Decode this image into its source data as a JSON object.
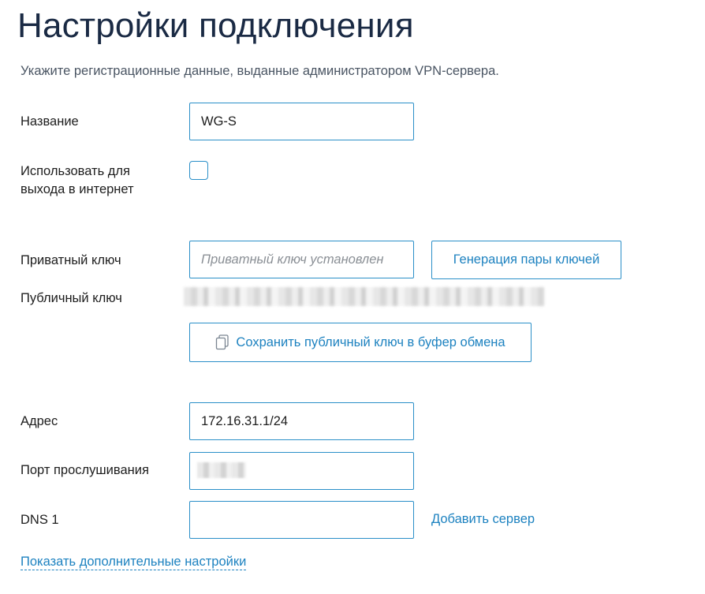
{
  "page": {
    "title": "Настройки подключения",
    "subtitle": "Укажите регистрационные данные, выданные администратором VPN-сервера."
  },
  "form": {
    "name": {
      "label": "Название",
      "value": "WG-S"
    },
    "internet": {
      "label_line1": "Использовать для",
      "label_line2": "выхода в интернет",
      "checked": false
    },
    "private_key": {
      "label": "Приватный ключ",
      "placeholder": "Приватный ключ установлен"
    },
    "generate_button": "Генерация пары ключей",
    "public_key": {
      "label": "Публичный ключ"
    },
    "copy_button": "Сохранить публичный ключ в буфер обмена",
    "address": {
      "label": "Адрес",
      "value": "172.16.31.1/24"
    },
    "listen_port": {
      "label": "Порт прослушивания"
    },
    "dns": {
      "label": "DNS 1",
      "value": ""
    },
    "add_server_link": "Добавить сервер",
    "advanced_link": "Показать дополнительные настройки"
  },
  "colors": {
    "accent": "#2a8fc8",
    "link": "#1d82c0",
    "title": "#1a2a44"
  }
}
